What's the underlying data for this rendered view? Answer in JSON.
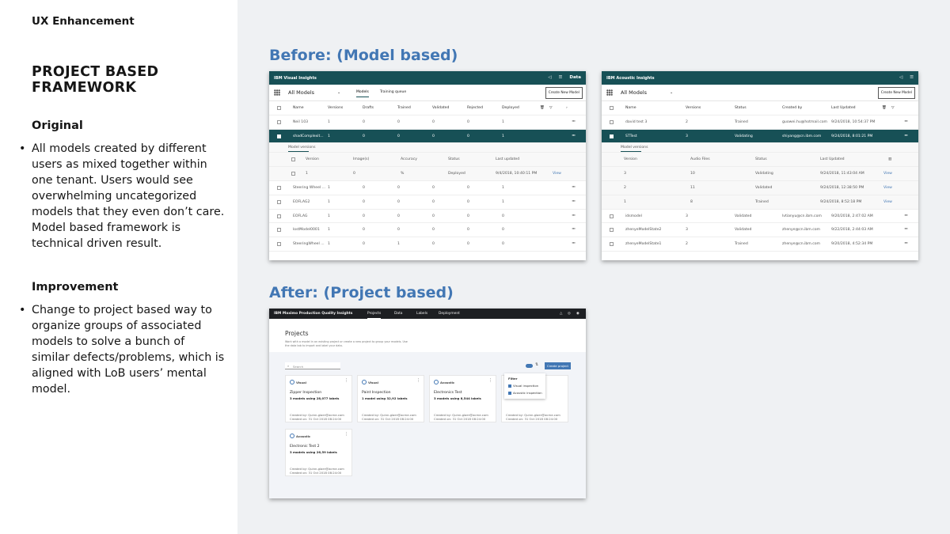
{
  "deck_label": "UX Enhancement",
  "slide_title": "PROJECT BASED FRAMEWORK",
  "original": {
    "heading": "Original",
    "text": "All models created by different users as mixed together within one tenant. Users would see overwhelming uncategorized models that they even don’t care. Model based framework is technical driven result."
  },
  "improvement": {
    "heading": "Improvement",
    "text": "Change to project based way to organize groups of associated models to solve a bunch of similar defects/problems, which is aligned with LoB users’ mental model."
  },
  "before_caption": "Before: (Model based)",
  "after_caption": "After: (Project based)",
  "visual": {
    "brand": "IBM Visual Insights",
    "right_item": "Data",
    "selector": "All Models",
    "tabs": [
      "Models",
      "Training queue"
    ],
    "create_button": "Create New Model",
    "columns": [
      "Name",
      "Versions",
      "Drafts",
      "Trained",
      "Validated",
      "Rejected",
      "Deployed"
    ],
    "rows": [
      {
        "name": "Neil 103",
        "v": "1",
        "d": "0",
        "t": "0",
        "va": "0",
        "r": "0",
        "de": "1"
      },
      {
        "name": "shadComplexit...",
        "v": "1",
        "d": "0",
        "t": "0",
        "va": "0",
        "r": "0",
        "de": "1"
      },
      {
        "name": "Steering Wheel ...",
        "v": "1",
        "d": "0",
        "t": "0",
        "va": "0",
        "r": "0",
        "de": "1"
      },
      {
        "name": "EOFLAG2",
        "v": "1",
        "d": "0",
        "t": "0",
        "va": "0",
        "r": "0",
        "de": "1"
      },
      {
        "name": "EOFLAG",
        "v": "1",
        "d": "0",
        "t": "0",
        "va": "0",
        "r": "0",
        "de": "0"
      },
      {
        "name": "lostModel0001",
        "v": "1",
        "d": "0",
        "t": "0",
        "va": "0",
        "r": "0",
        "de": "0"
      },
      {
        "name": "SteeringWheel ...",
        "v": "1",
        "d": "0",
        "t": "1",
        "va": "0",
        "r": "0",
        "de": "0"
      }
    ],
    "sub_tab": "Model versions",
    "sub_columns": [
      "Version",
      "Image(s)",
      "Accuracy",
      "Status",
      "Last updated"
    ],
    "sub_row": {
      "version": "1",
      "images": "0",
      "accuracy": "%",
      "status": "Deployed",
      "updated": "9/4/2018, 10:40:11 PM",
      "action": "View"
    }
  },
  "acoustic": {
    "brand": "IBM Acoustic Insights",
    "selector": "All Models",
    "create_button": "Create New Model",
    "columns": [
      "Name",
      "Versions",
      "Status",
      "Created by",
      "Last Updated"
    ],
    "rows": [
      {
        "name": "david test 3",
        "v": "2",
        "s": "Trained",
        "by": "guowei.hu@hotmail.com",
        "up": "9/24/2018, 10:54:37 PM"
      },
      {
        "name": "STTest",
        "v": "3",
        "s": "Validating",
        "by": "shiyang@cn.ibm.com",
        "up": "9/24/2018, 8:01:21 PM"
      }
    ],
    "sub_tab": "Model versions",
    "sub_columns": [
      "Version",
      "Audio Files",
      "Status",
      "Last Updated"
    ],
    "sub_rows": [
      {
        "v": "3",
        "a": "10",
        "s": "Validating",
        "u": "9/24/2018, 11:43:04 AM",
        "act": "View"
      },
      {
        "v": "2",
        "a": "11",
        "s": "Validated",
        "u": "9/24/2018, 12:38:50 PM",
        "act": "View"
      },
      {
        "v": "1",
        "a": "8",
        "s": "Trained",
        "u": "9/24/2018, 8:52:18 PM",
        "act": "View"
      }
    ],
    "rows_after": [
      {
        "name": "idsmodel",
        "v": "3",
        "s": "Validated",
        "by": "lvtianyu@cn.ibm.com",
        "up": "9/20/2018, 2:47:02 AM"
      },
      {
        "name": "zhenyeModelState2",
        "v": "3",
        "s": "Validated",
        "by": "zhenye@cn.ibm.com",
        "up": "9/22/2018, 2:44:03 AM"
      },
      {
        "name": "zhenyeModelState1",
        "v": "2",
        "s": "Trained",
        "by": "zhenye@cn.ibm.com",
        "up": "9/20/2018, 4:52:34 PM"
      }
    ]
  },
  "after": {
    "brand": "IBM Maximo Production Quality Insights",
    "nav": [
      "Projects",
      "Data",
      "Labels",
      "Deployment"
    ],
    "title": "Projects",
    "description": "Work with a model in an existing project or create a new project to group your models. Use the data tab to import and label your data.",
    "search_placeholder": "Search",
    "create_button": "Create project",
    "filter": {
      "title": "Filter",
      "options": [
        "Visual inspection",
        "Acoustic inspection"
      ]
    },
    "cards": [
      {
        "type": "Visual",
        "name": "Zipper Inspection",
        "models": "3 models using 28,077 labels",
        "by": "Quinn.glaer@acme.com",
        "on": "31 Oct 2018 08:24:00"
      },
      {
        "type": "Visual",
        "name": "Paint Inspection",
        "models": "1 model using 32,92 labels",
        "by": "Quinn.glaer@acme.com",
        "on": "31 Oct 2018 08:24:00"
      },
      {
        "type": "Acoustic",
        "name": "Electronics Test",
        "models": "3 models using 8,544 labels",
        "by": "Quinn.glaer@acme.com",
        "on": "31 Oct 2018 08:24:00"
      },
      {
        "type": "",
        "name": "",
        "models": "",
        "by": "Quinn.glaer@acme.com",
        "on": "31 Oct 2018 08:24:00"
      },
      {
        "type": "Acoustic",
        "name": "Electronic Test 2",
        "models": "3 models using 26,59 labels",
        "by": "Quinn.glaer@acme.com",
        "on": "31 Oct 2018 08:24:00"
      }
    ],
    "meta_labels": {
      "by": "Created by:",
      "on": "Created on:"
    }
  }
}
